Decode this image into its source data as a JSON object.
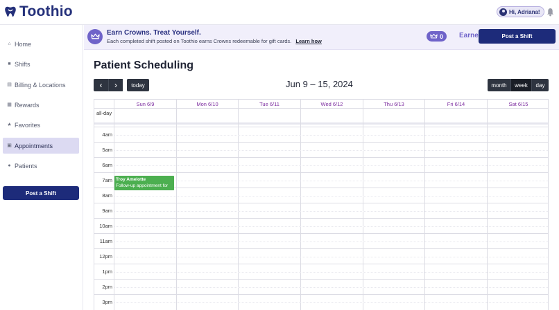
{
  "app": {
    "name": "Toothio"
  },
  "header": {
    "greeting": "Hi, Adriana!"
  },
  "sidebar": {
    "items": [
      {
        "label": "Home",
        "icon": "home-icon"
      },
      {
        "label": "Shifts",
        "icon": "briefcase-icon"
      },
      {
        "label": "Billing & Locations",
        "icon": "card-icon"
      },
      {
        "label": "Rewards",
        "icon": "gift-icon"
      },
      {
        "label": "Favorites",
        "icon": "star-icon"
      },
      {
        "label": "Appointments",
        "icon": "calendar-icon",
        "active": true
      },
      {
        "label": "Patients",
        "icon": "person-icon"
      }
    ],
    "post_label": "Post a Shift"
  },
  "banner": {
    "title": "Earn Crowns. Treat Yourself.",
    "text": "Each completed shift posted on Toothio earns Crowns redeemable for gift cards.",
    "link": "Learn how",
    "crowns": "0",
    "earned_label": "Earned",
    "post_label": "Post a Shift"
  },
  "page": {
    "title": "Patient Scheduling"
  },
  "toolbar": {
    "prev": "‹",
    "next": "›",
    "today": "today",
    "date_range": "Jun 9 – 15, 2024",
    "views": [
      "month",
      "week",
      "day"
    ],
    "active_view": "week"
  },
  "calendar": {
    "days": [
      "Sun 6/9",
      "Mon 6/10",
      "Tue 6/11",
      "Wed 6/12",
      "Thu 6/13",
      "Fri 6/14",
      "Sat 6/15"
    ],
    "allday_label": "all-day",
    "hours": [
      "4am",
      "5am",
      "6am",
      "7am",
      "8am",
      "9am",
      "10am",
      "11am",
      "12pm",
      "1pm",
      "2pm",
      "3pm"
    ],
    "events": [
      {
        "title": "Troy Amelotte",
        "description": "Follow-up appointment for",
        "day": "Sun 6/9",
        "start": "7am"
      }
    ]
  },
  "colors": {
    "brand": "#24307a",
    "primary_button": "#1d2b7a",
    "crown_purple": "#6f63c9",
    "event_green": "#4caf50",
    "day_header": "#7a2a9e"
  }
}
